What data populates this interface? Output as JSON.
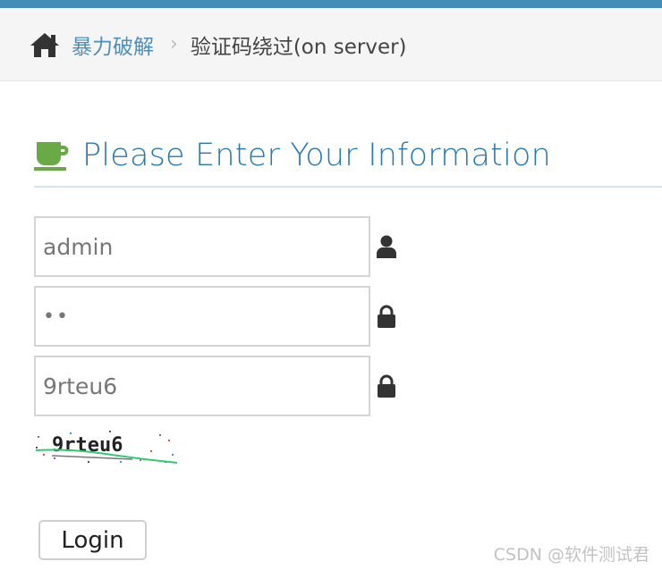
{
  "breadcrumb": {
    "home_icon": "home-icon",
    "parent_label": "暴力破解",
    "separator": "›",
    "current_label": "验证码绕过(on server)"
  },
  "header": {
    "icon": "coffee-icon",
    "title": "Please Enter Your Information"
  },
  "form": {
    "username": {
      "value": "admin",
      "icon": "user-icon"
    },
    "password": {
      "value": "••",
      "icon": "lock-icon"
    },
    "captcha_input": {
      "value": "9rteu6",
      "icon": "lock-icon"
    },
    "captcha_image": {
      "text": "9rteu6"
    },
    "login_label": "Login"
  },
  "watermark": "CSDN @软件测试君",
  "colors": {
    "topbar": "#438eb9",
    "link": "#4c8fbd",
    "header_text": "#2679b5",
    "coffee_icon": "#69aa46"
  }
}
